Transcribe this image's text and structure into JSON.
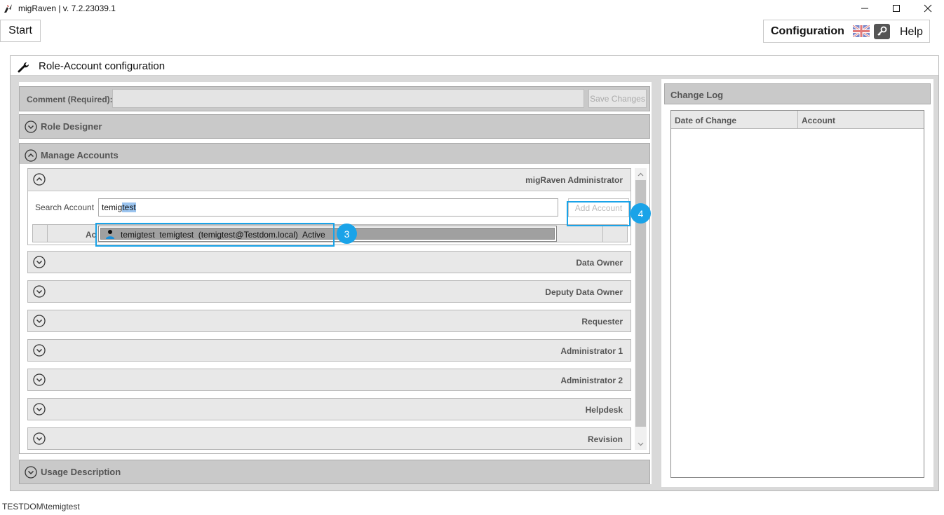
{
  "window": {
    "title": "migRaven | v. 7.2.23039.1",
    "icons": {
      "app": "raven-logo-icon",
      "minimize": "minimize-icon",
      "maximize": "maximize-icon",
      "close": "close-icon"
    }
  },
  "toolbar": {
    "start_label": "Start",
    "configuration_label": "Configuration",
    "help_label": "Help",
    "language_icon": "uk-flag-icon",
    "key_icon": "key-icon"
  },
  "main": {
    "title": "Role-Account configuration",
    "title_icon": "wrench-icon",
    "comment": {
      "label": "Comment (Required):",
      "value": "",
      "save_label": "Save Changes"
    },
    "sections": {
      "role_designer": "Role Designer",
      "manage_accounts": "Manage Accounts",
      "usage_description": "Usage Description"
    },
    "roles": [
      {
        "label": "migRaven Administrator",
        "expanded": true
      },
      {
        "label": "Data Owner"
      },
      {
        "label": "Deputy Data Owner"
      },
      {
        "label": "Requester"
      },
      {
        "label": "Administrator 1"
      },
      {
        "label": "Administrator 2"
      },
      {
        "label": "Helpdesk"
      },
      {
        "label": "Revision"
      }
    ],
    "search": {
      "label": "Search Account",
      "value_plain": "temig",
      "value_selected": "test",
      "add_account_label": "Add Account",
      "table_column": "Ac"
    },
    "suggestion": {
      "text": "temigtest  temigtest  (temigtest@Testdom.local)  Active",
      "icon": "user-icon"
    },
    "badges": {
      "suggestion": "3",
      "add_account": "4"
    }
  },
  "change_log": {
    "title": "Change Log",
    "columns": [
      "Date of Change",
      "Account"
    ]
  },
  "status_bar": {
    "user": "TESTDOM\\temigtest"
  },
  "colors": {
    "highlight": "#1aa3e8",
    "section_gray": "#c9c9c9",
    "selection": "#9bc4ef"
  }
}
